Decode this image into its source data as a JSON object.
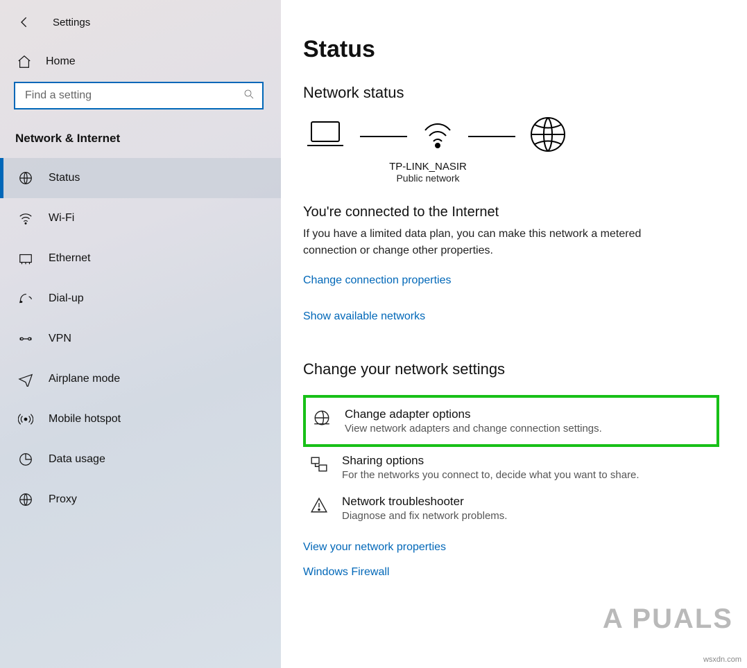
{
  "header": {
    "app_title": "Settings"
  },
  "sidebar": {
    "home_label": "Home",
    "search_placeholder": "Find a setting",
    "section_title": "Network & Internet",
    "items": [
      {
        "label": "Status"
      },
      {
        "label": "Wi-Fi"
      },
      {
        "label": "Ethernet"
      },
      {
        "label": "Dial-up"
      },
      {
        "label": "VPN"
      },
      {
        "label": "Airplane mode"
      },
      {
        "label": "Mobile hotspot"
      },
      {
        "label": "Data usage"
      },
      {
        "label": "Proxy"
      }
    ]
  },
  "main": {
    "title": "Status",
    "status_heading": "Network status",
    "topology": {
      "ssid": "TP-LINK_NASIR",
      "net_type": "Public network"
    },
    "connected_heading": "You're connected to the Internet",
    "connected_body": "If you have a limited data plan, you can make this network a metered connection or change other properties.",
    "link_change_props": "Change connection properties",
    "link_show_networks": "Show available networks",
    "change_heading": "Change your network settings",
    "options": [
      {
        "title": "Change adapter options",
        "desc": "View network adapters and change connection settings."
      },
      {
        "title": "Sharing options",
        "desc": "For the networks you connect to, decide what you want to share."
      },
      {
        "title": "Network troubleshooter",
        "desc": "Diagnose and fix network problems."
      }
    ],
    "link_view_props": "View your network properties",
    "link_firewall": "Windows Firewall"
  },
  "watermark": {
    "text": "A   PUALS"
  },
  "corner": {
    "text": "wsxdn.com"
  }
}
